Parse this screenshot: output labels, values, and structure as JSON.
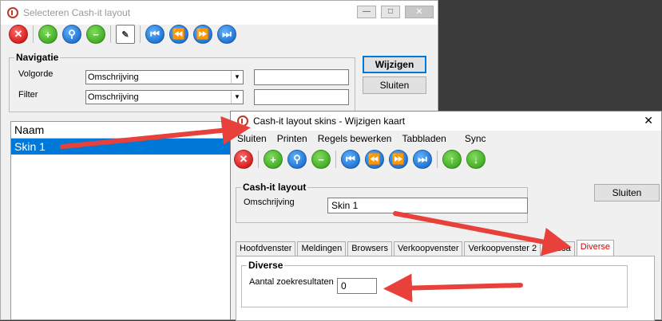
{
  "window1": {
    "title": "Selecteren Cash-it layout",
    "toolbar_icons": [
      "close-icon",
      "add-icon",
      "search-icon",
      "remove-icon",
      "clipboard-icon",
      "first-icon",
      "previous-icon",
      "next-icon",
      "last-icon"
    ],
    "navigation": {
      "legend": "Navigatie",
      "volgorde_label": "Volgorde",
      "volgorde_value": "Omschrijving",
      "filter_label": "Filter",
      "filter_value": "Omschrijving",
      "volgorde_text": "",
      "filter_text": ""
    },
    "buttons": {
      "edit": "Wijzigen",
      "close": "Sluiten"
    },
    "list": {
      "header": "Naam",
      "rows": [
        "Skin 1"
      ]
    }
  },
  "window2": {
    "title": "Cash-it layout skins - Wijzigen kaart",
    "menu": [
      "Sluiten",
      "Printen",
      "Regels bewerken",
      "Tabbladen",
      "Sync"
    ],
    "group": {
      "legend": "Cash-it layout",
      "field_label": "Omschrijving",
      "field_value": "Skin 1"
    },
    "close_button": "Sluiten",
    "tabs": [
      "Hoofdvenster",
      "Meldingen",
      "Browsers",
      "Verkoopvenster",
      "Verkoopvenster 2",
      "Kassa",
      "Diverse"
    ],
    "active_tab": "Diverse",
    "diverse": {
      "legend": "Diverse",
      "label": "Aantal zoekresultaten",
      "value": "0"
    }
  },
  "colors": {
    "annotation_arrow": "#e8403a",
    "selection": "#0078d7",
    "active_tab_text": "#dd0000"
  }
}
